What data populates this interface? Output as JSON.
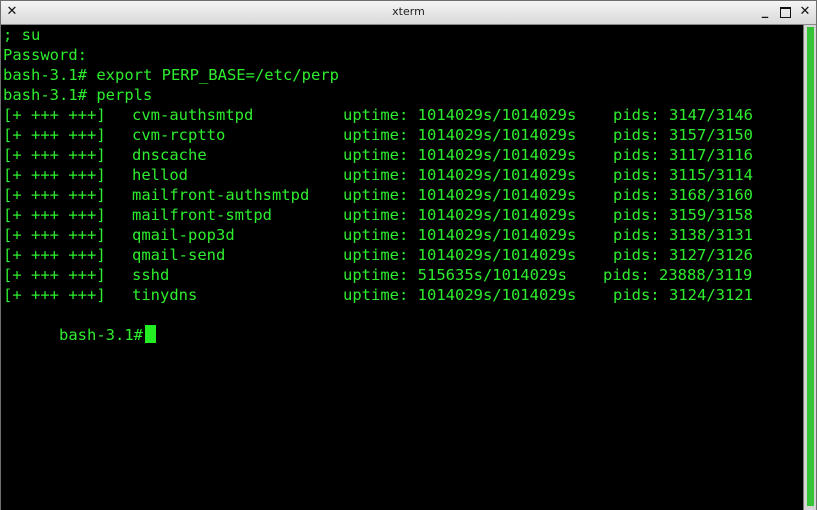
{
  "window": {
    "title": "xterm",
    "close_left_glyph": "✕",
    "minimize_glyph": "_",
    "close_glyph": "✕"
  },
  "terminal": {
    "lines": [
      "; su",
      "Password:",
      "bash-3.1# export PERP_BASE=/etc/perp",
      "bash-3.1# perpls"
    ],
    "services": [
      {
        "status": "[+ +++ +++]",
        "name": "cvm-authsmtpd",
        "uptime": "uptime: 1014029s/1014029s",
        "pids": "pids: 3147/3146"
      },
      {
        "status": "[+ +++ +++]",
        "name": "cvm-rcptto",
        "uptime": "uptime: 1014029s/1014029s",
        "pids": "pids: 3157/3150"
      },
      {
        "status": "[+ +++ +++]",
        "name": "dnscache",
        "uptime": "uptime: 1014029s/1014029s",
        "pids": "pids: 3117/3116"
      },
      {
        "status": "[+ +++ +++]",
        "name": "hellod",
        "uptime": "uptime: 1014029s/1014029s",
        "pids": "pids: 3115/3114"
      },
      {
        "status": "[+ +++ +++]",
        "name": "mailfront-authsmtpd",
        "uptime": "uptime: 1014029s/1014029s",
        "pids": "pids: 3168/3160"
      },
      {
        "status": "[+ +++ +++]",
        "name": "mailfront-smtpd",
        "uptime": "uptime: 1014029s/1014029s",
        "pids": "pids: 3159/3158"
      },
      {
        "status": "[+ +++ +++]",
        "name": "qmail-pop3d",
        "uptime": "uptime: 1014029s/1014029s",
        "pids": "pids: 3138/3131"
      },
      {
        "status": "[+ +++ +++]",
        "name": "qmail-send",
        "uptime": "uptime: 1014029s/1014029s",
        "pids": "pids: 3127/3126"
      },
      {
        "status": "[+ +++ +++]",
        "name": "sshd",
        "uptime": "uptime: 515635s/1014029s",
        "pids": "pids: 23888/3119"
      },
      {
        "status": "[+ +++ +++]",
        "name": "tinydns",
        "uptime": "uptime: 1014029s/1014029s",
        "pids": "pids: 3124/3121"
      }
    ],
    "prompt": "bash-3.1#",
    "text_color": "#2eed2e",
    "background_color": "#000000"
  }
}
